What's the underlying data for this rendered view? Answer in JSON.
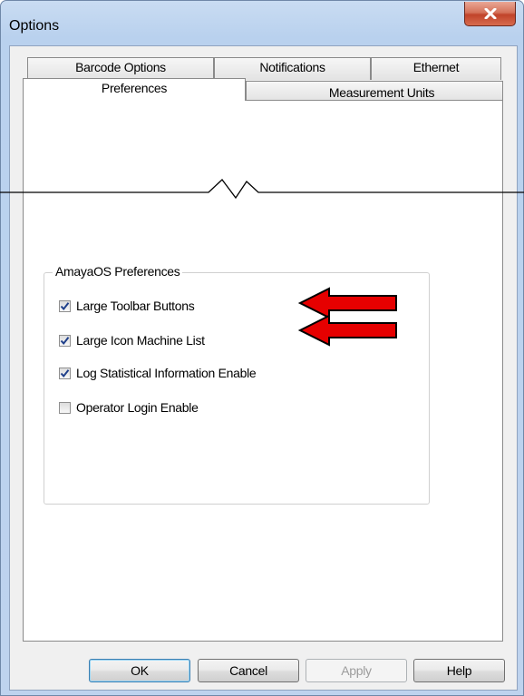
{
  "window": {
    "title": "Options",
    "close_label": "X"
  },
  "tabs": {
    "row_top": [
      "Barcode Options",
      "Notifications",
      "Ethernet"
    ],
    "row_bottom": [
      "Preferences",
      "Measurement Units"
    ],
    "active": "Preferences"
  },
  "group": {
    "title": "AmayaOS Preferences",
    "options": [
      {
        "label": "Large Toolbar Buttons",
        "checked": true
      },
      {
        "label": "Large Icon Machine List",
        "checked": true
      },
      {
        "label": "Log Statistical Information Enable",
        "checked": true
      },
      {
        "label": "Operator Login Enable",
        "checked": false
      }
    ]
  },
  "buttons": {
    "ok": "OK",
    "cancel": "Cancel",
    "apply": "Apply",
    "help": "Help"
  },
  "colors": {
    "arrow": "#e60000",
    "check": "#1e3f8a"
  }
}
